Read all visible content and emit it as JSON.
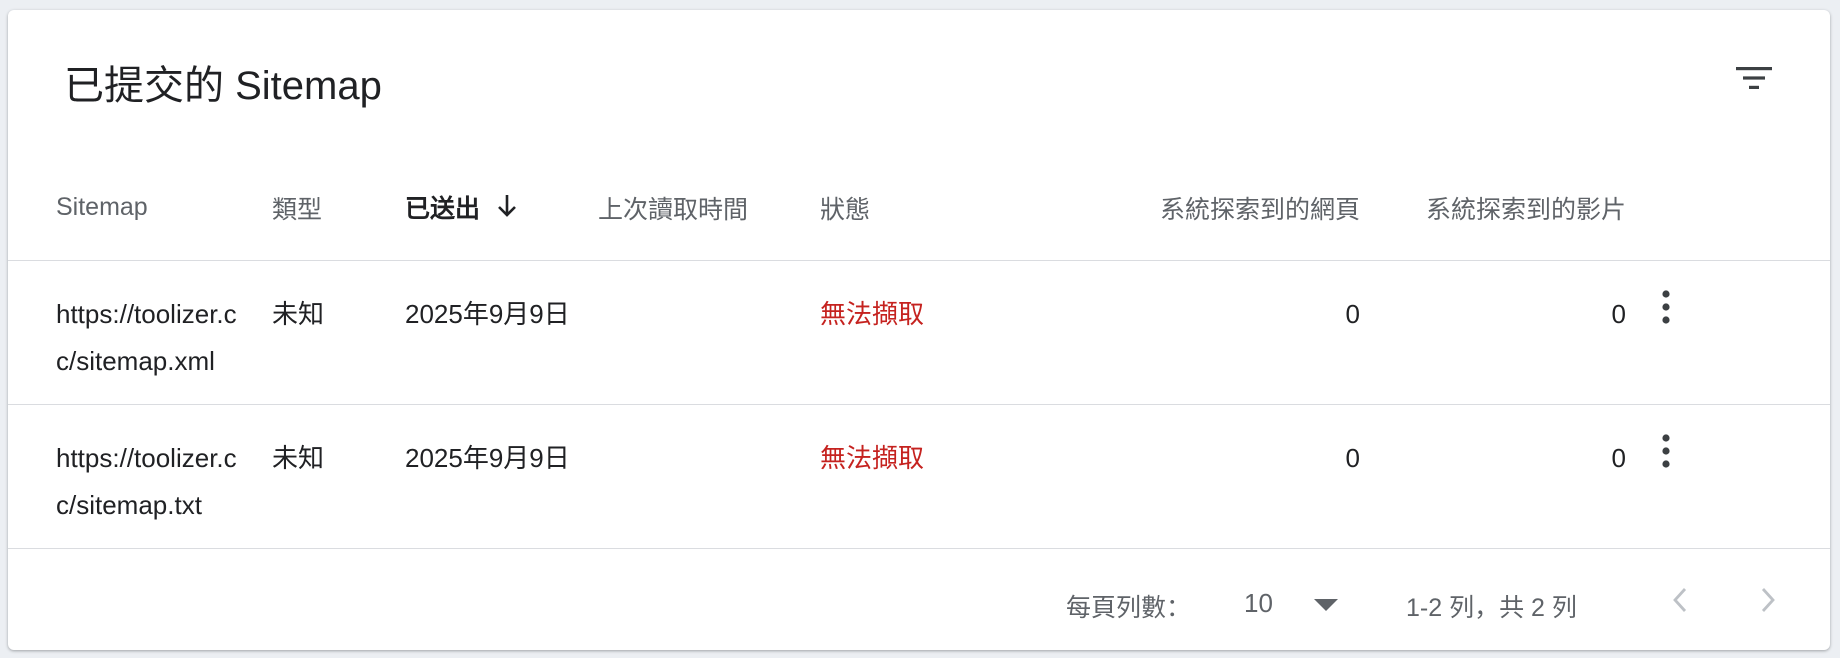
{
  "card": {
    "title": "已提交的 Sitemap"
  },
  "icons": {
    "filter": "filter-list-icon",
    "sort": "arrow-downward-icon",
    "more": "more-vert-icon",
    "prev": "chevron-left-icon",
    "next": "chevron-right-icon",
    "dropdown": "arrow-drop-down-icon"
  },
  "colors": {
    "error": "#c5221f",
    "muted": "#5f6368",
    "text": "#202124",
    "divider": "#dadce0"
  },
  "table": {
    "headers": {
      "sitemap": "Sitemap",
      "type": "類型",
      "submitted": "已送出",
      "last_read": "上次讀取時間",
      "status": "狀態",
      "pages": "系統探索到的網頁",
      "videos": "系統探索到的影片"
    },
    "sorted_column": "submitted",
    "sort_direction": "descending",
    "rows": [
      {
        "url": "https://toolizer.cc/sitemap.xml",
        "type": "未知",
        "submitted": "2025年9月9日",
        "last_read": "",
        "status": "無法擷取",
        "pages": "0",
        "videos": "0"
      },
      {
        "url": "https://toolizer.cc/sitemap.txt",
        "type": "未知",
        "submitted": "2025年9月9日",
        "last_read": "",
        "status": "無法擷取",
        "pages": "0",
        "videos": "0"
      }
    ]
  },
  "pagination": {
    "rows_per_page_label": "每頁列數：",
    "rows_per_page": "10",
    "range": "1-2 列，共 2 列"
  }
}
